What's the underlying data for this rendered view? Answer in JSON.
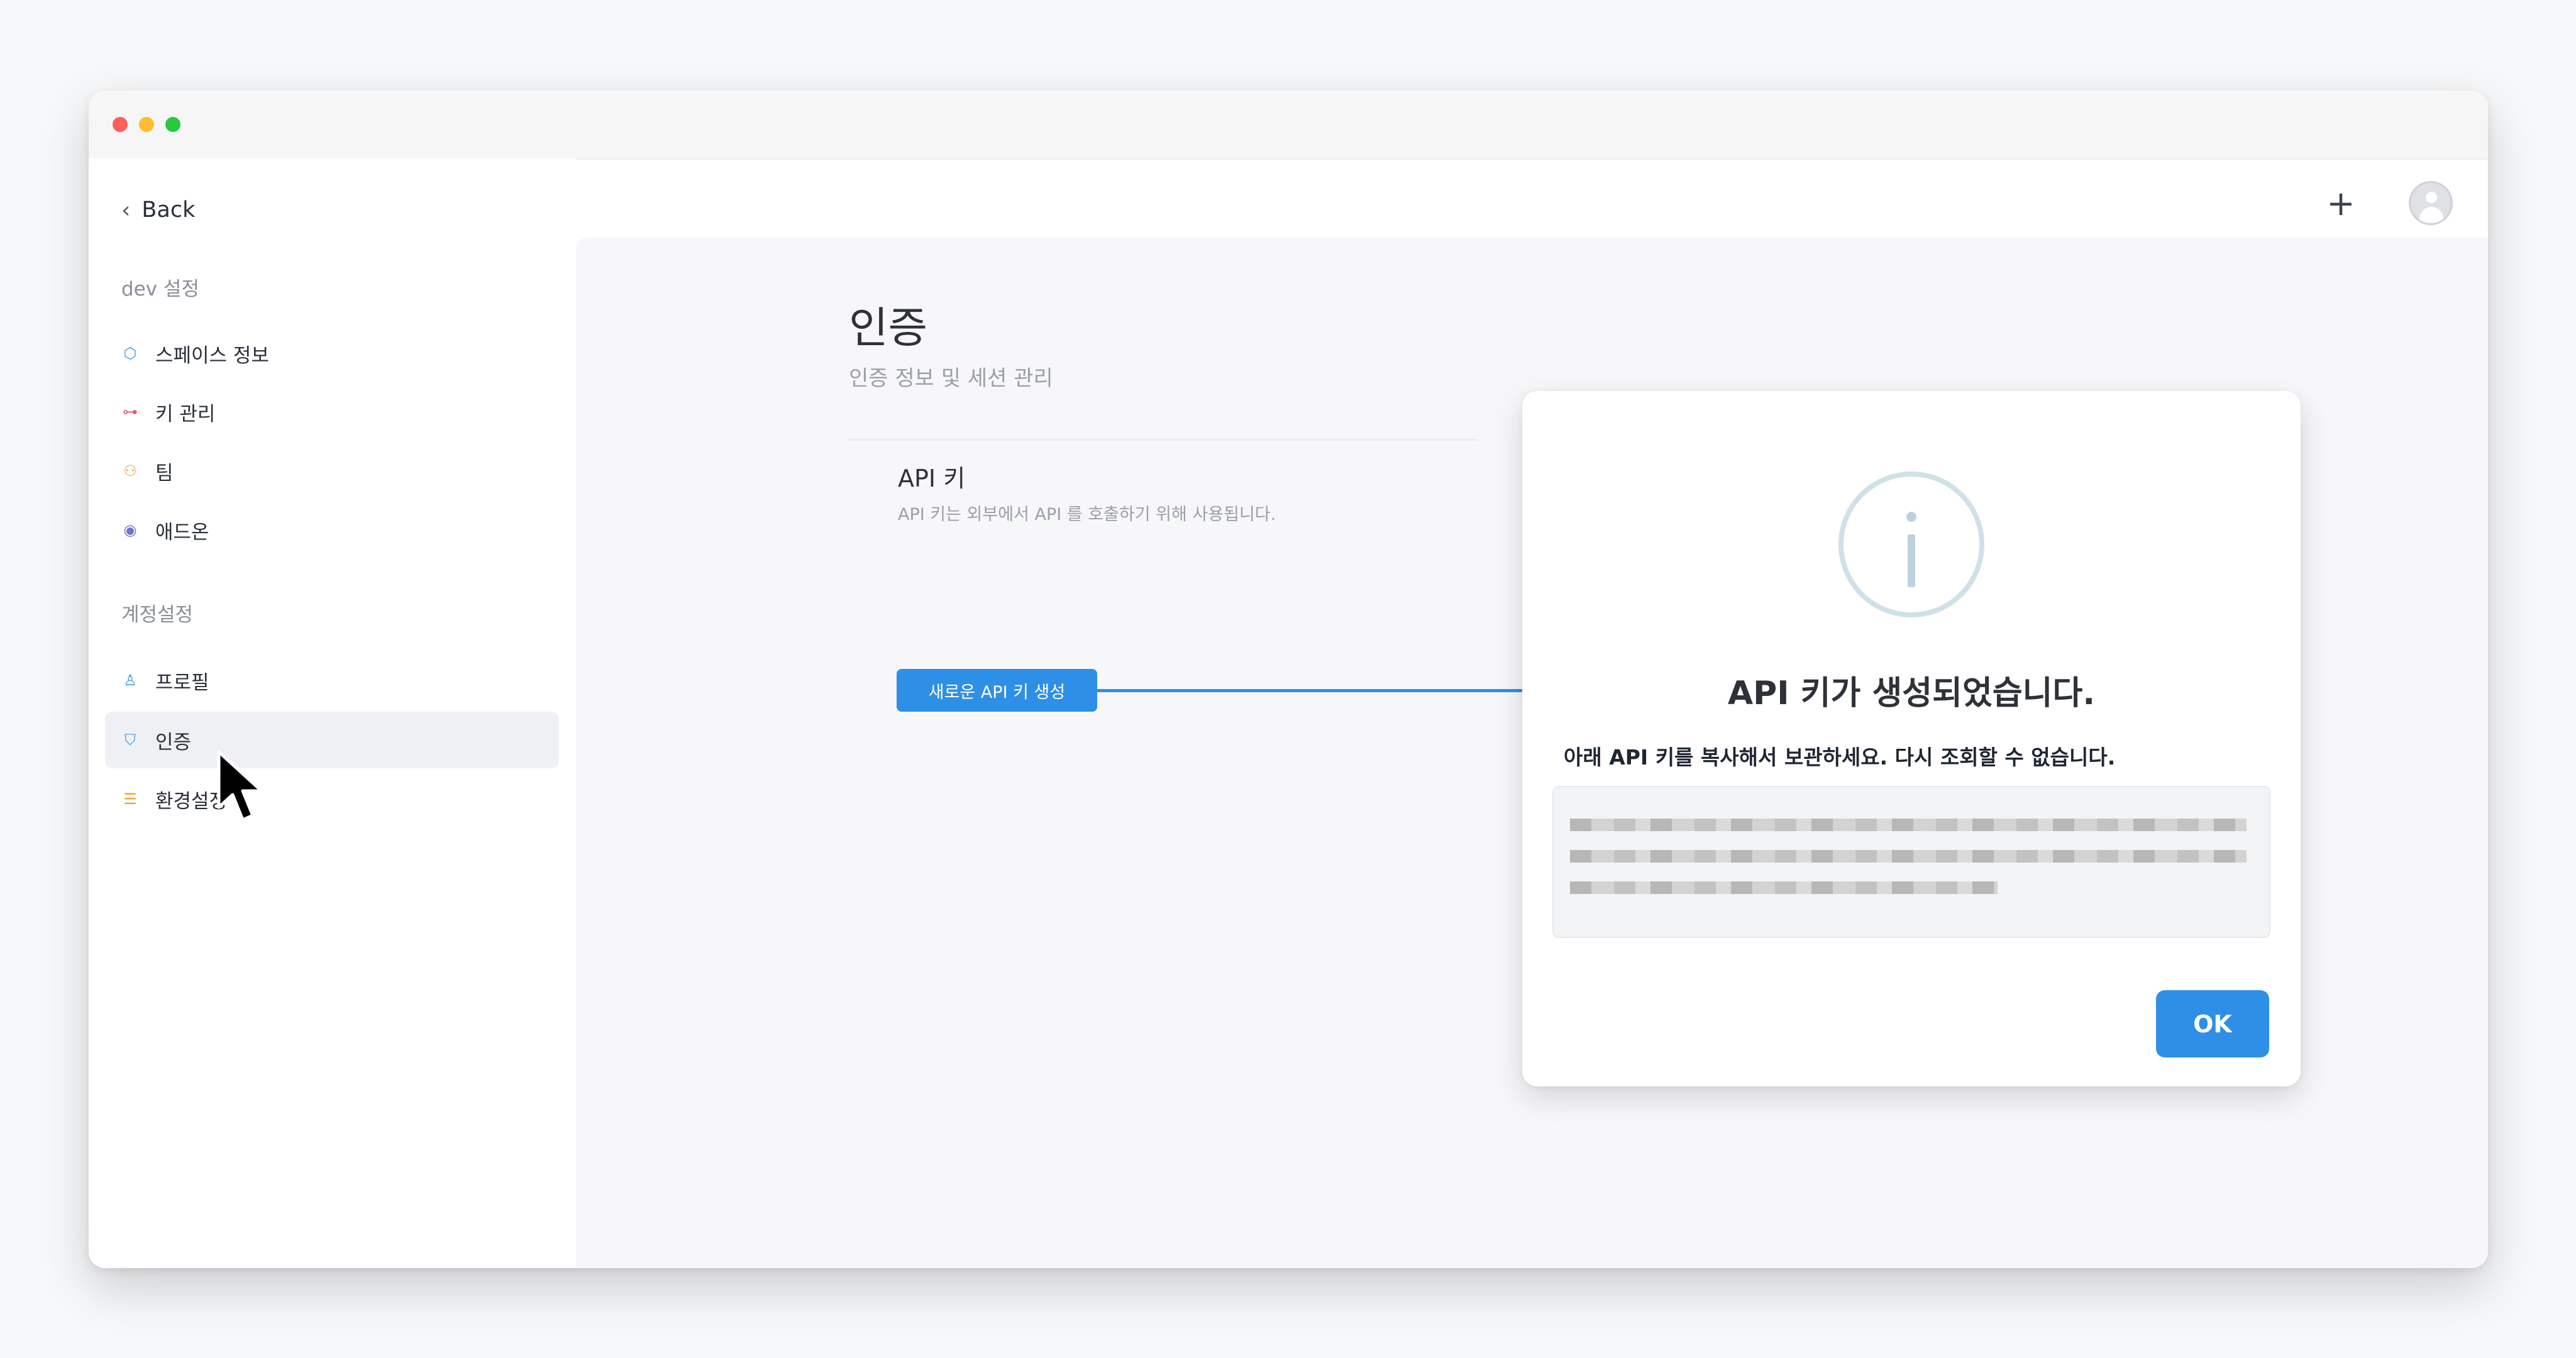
{
  "nav": {
    "back_label": "Back",
    "section_dev": "dev 설정",
    "dev_items": [
      {
        "label": "스페이스 정보",
        "icon": "cube-icon"
      },
      {
        "label": "키 관리",
        "icon": "key-icon"
      },
      {
        "label": "팀",
        "icon": "team-icon"
      },
      {
        "label": "애드온",
        "icon": "addon-icon"
      }
    ],
    "section_account": "계정설정",
    "account_items": [
      {
        "label": "프로필",
        "icon": "user-icon"
      },
      {
        "label": "인증",
        "icon": "shield-icon",
        "active": true
      },
      {
        "label": "환경설정",
        "icon": "sliders-icon"
      }
    ]
  },
  "header": {
    "add_icon": "plus-icon",
    "avatar_icon": "avatar-icon"
  },
  "page": {
    "title": "인증",
    "subtitle": "인증 정보 및 세션 관리",
    "api_section_title": "API 키",
    "api_section_desc": "API 키는 외부에서 API 를 호출하기 위해 사용됩니다.",
    "create_button": "새로운 API 키 생성"
  },
  "modal": {
    "icon": "info-icon",
    "title": "API 키가 생성되었습니다.",
    "message": "아래 API 키를 복사해서 보관하세요. 다시 조회할 수 없습니다.",
    "ok_button": "OK"
  },
  "colors": {
    "accent": "#2e8fe6",
    "active_nav_bg": "#eef0f4",
    "info_icon": "#cfe0e8"
  }
}
